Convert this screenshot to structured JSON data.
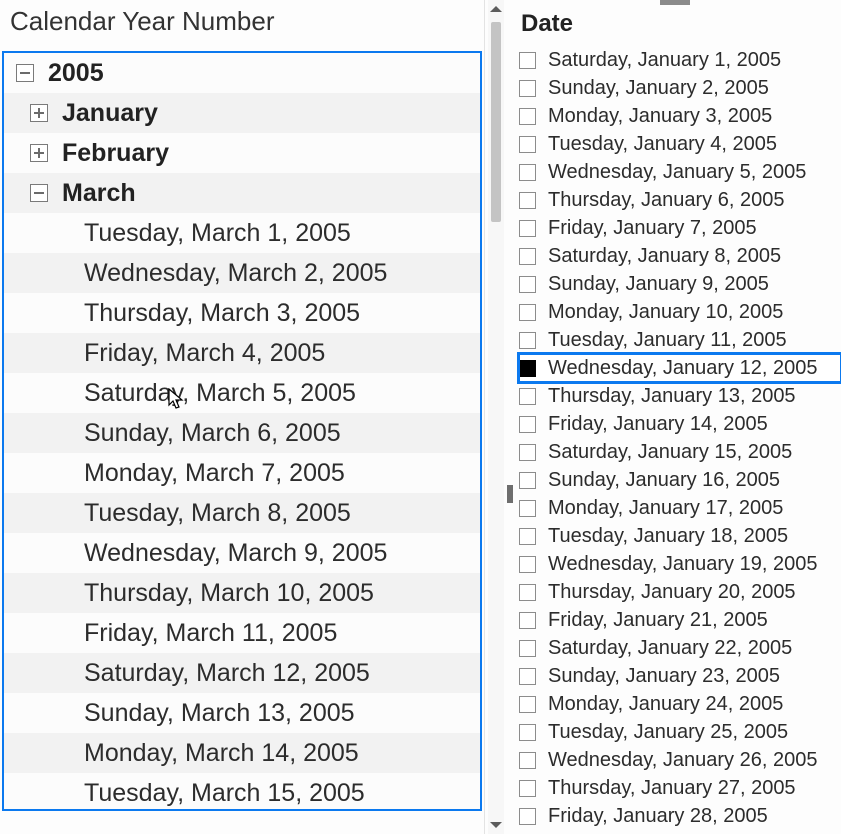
{
  "left": {
    "title": "Calendar Year Number",
    "tree": [
      {
        "level": 1,
        "label": "2005",
        "kind": "year",
        "expander": "expanded"
      },
      {
        "level": 2,
        "label": "January",
        "kind": "month",
        "expander": "collapsed"
      },
      {
        "level": 2,
        "label": "February",
        "kind": "month",
        "expander": "collapsed"
      },
      {
        "level": 2,
        "label": "March",
        "kind": "month",
        "expander": "expanded"
      },
      {
        "level": 3,
        "label": "Tuesday, March 1, 2005",
        "kind": "day"
      },
      {
        "level": 3,
        "label": "Wednesday, March 2, 2005",
        "kind": "day"
      },
      {
        "level": 3,
        "label": "Thursday, March 3, 2005",
        "kind": "day"
      },
      {
        "level": 3,
        "label": "Friday, March 4, 2005",
        "kind": "day"
      },
      {
        "level": 3,
        "label": "Saturday, March 5, 2005",
        "kind": "day"
      },
      {
        "level": 3,
        "label": "Sunday, March 6, 2005",
        "kind": "day"
      },
      {
        "level": 3,
        "label": "Monday, March 7, 2005",
        "kind": "day"
      },
      {
        "level": 3,
        "label": "Tuesday, March 8, 2005",
        "kind": "day"
      },
      {
        "level": 3,
        "label": "Wednesday, March 9, 2005",
        "kind": "day"
      },
      {
        "level": 3,
        "label": "Thursday, March 10, 2005",
        "kind": "day"
      },
      {
        "level": 3,
        "label": "Friday, March 11, 2005",
        "kind": "day"
      },
      {
        "level": 3,
        "label": "Saturday, March 12, 2005",
        "kind": "day"
      },
      {
        "level": 3,
        "label": "Sunday, March 13, 2005",
        "kind": "day"
      },
      {
        "level": 3,
        "label": "Monday, March 14, 2005",
        "kind": "day"
      },
      {
        "level": 3,
        "label": "Tuesday, March 15, 2005",
        "kind": "day"
      }
    ]
  },
  "right": {
    "title": "Date",
    "selected_index": 11,
    "items": [
      {
        "label": "Saturday, January 1, 2005",
        "checked": false
      },
      {
        "label": "Sunday, January 2, 2005",
        "checked": false
      },
      {
        "label": "Monday, January 3, 2005",
        "checked": false
      },
      {
        "label": "Tuesday, January 4, 2005",
        "checked": false
      },
      {
        "label": "Wednesday, January 5, 2005",
        "checked": false
      },
      {
        "label": "Thursday, January 6, 2005",
        "checked": false
      },
      {
        "label": "Friday, January 7, 2005",
        "checked": false
      },
      {
        "label": "Saturday, January 8, 2005",
        "checked": false
      },
      {
        "label": "Sunday, January 9, 2005",
        "checked": false
      },
      {
        "label": "Monday, January 10, 2005",
        "checked": false
      },
      {
        "label": "Tuesday, January 11, 2005",
        "checked": false
      },
      {
        "label": "Wednesday, January 12, 2005",
        "checked": true
      },
      {
        "label": "Thursday, January 13, 2005",
        "checked": false
      },
      {
        "label": "Friday, January 14, 2005",
        "checked": false
      },
      {
        "label": "Saturday, January 15, 2005",
        "checked": false
      },
      {
        "label": "Sunday, January 16, 2005",
        "checked": false
      },
      {
        "label": "Monday, January 17, 2005",
        "checked": false
      },
      {
        "label": "Tuesday, January 18, 2005",
        "checked": false
      },
      {
        "label": "Wednesday, January 19, 2005",
        "checked": false
      },
      {
        "label": "Thursday, January 20, 2005",
        "checked": false
      },
      {
        "label": "Friday, January 21, 2005",
        "checked": false
      },
      {
        "label": "Saturday, January 22, 2005",
        "checked": false
      },
      {
        "label": "Sunday, January 23, 2005",
        "checked": false
      },
      {
        "label": "Monday, January 24, 2005",
        "checked": false
      },
      {
        "label": "Tuesday, January 25, 2005",
        "checked": false
      },
      {
        "label": "Wednesday, January 26, 2005",
        "checked": false
      },
      {
        "label": "Thursday, January 27, 2005",
        "checked": false
      },
      {
        "label": "Friday, January 28, 2005",
        "checked": false
      }
    ]
  }
}
